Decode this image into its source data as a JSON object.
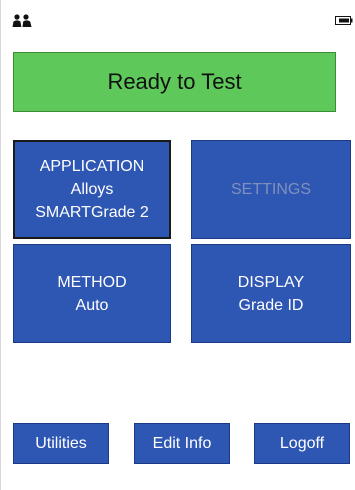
{
  "status_bar": {
    "user_icon": "user-group-icon",
    "battery_icon": "battery-icon"
  },
  "status_banner": {
    "text": "Ready to Test",
    "color": "#5ec95a"
  },
  "tiles": {
    "application": {
      "title": "APPLICATION",
      "lines": [
        "Alloys",
        "SMARTGrade 2"
      ]
    },
    "settings": {
      "title": "SETTINGS",
      "enabled": false
    },
    "method": {
      "title": "METHOD",
      "value": "Auto"
    },
    "display": {
      "title": "DISPLAY",
      "value": "Grade ID"
    }
  },
  "buttons": {
    "utilities": "Utilities",
    "edit_info": "Edit Info",
    "logoff": "Logoff"
  },
  "colors": {
    "tile_bg": "#2e56b3",
    "text": "#ffffff",
    "disabled_text": "#7f90bd"
  }
}
